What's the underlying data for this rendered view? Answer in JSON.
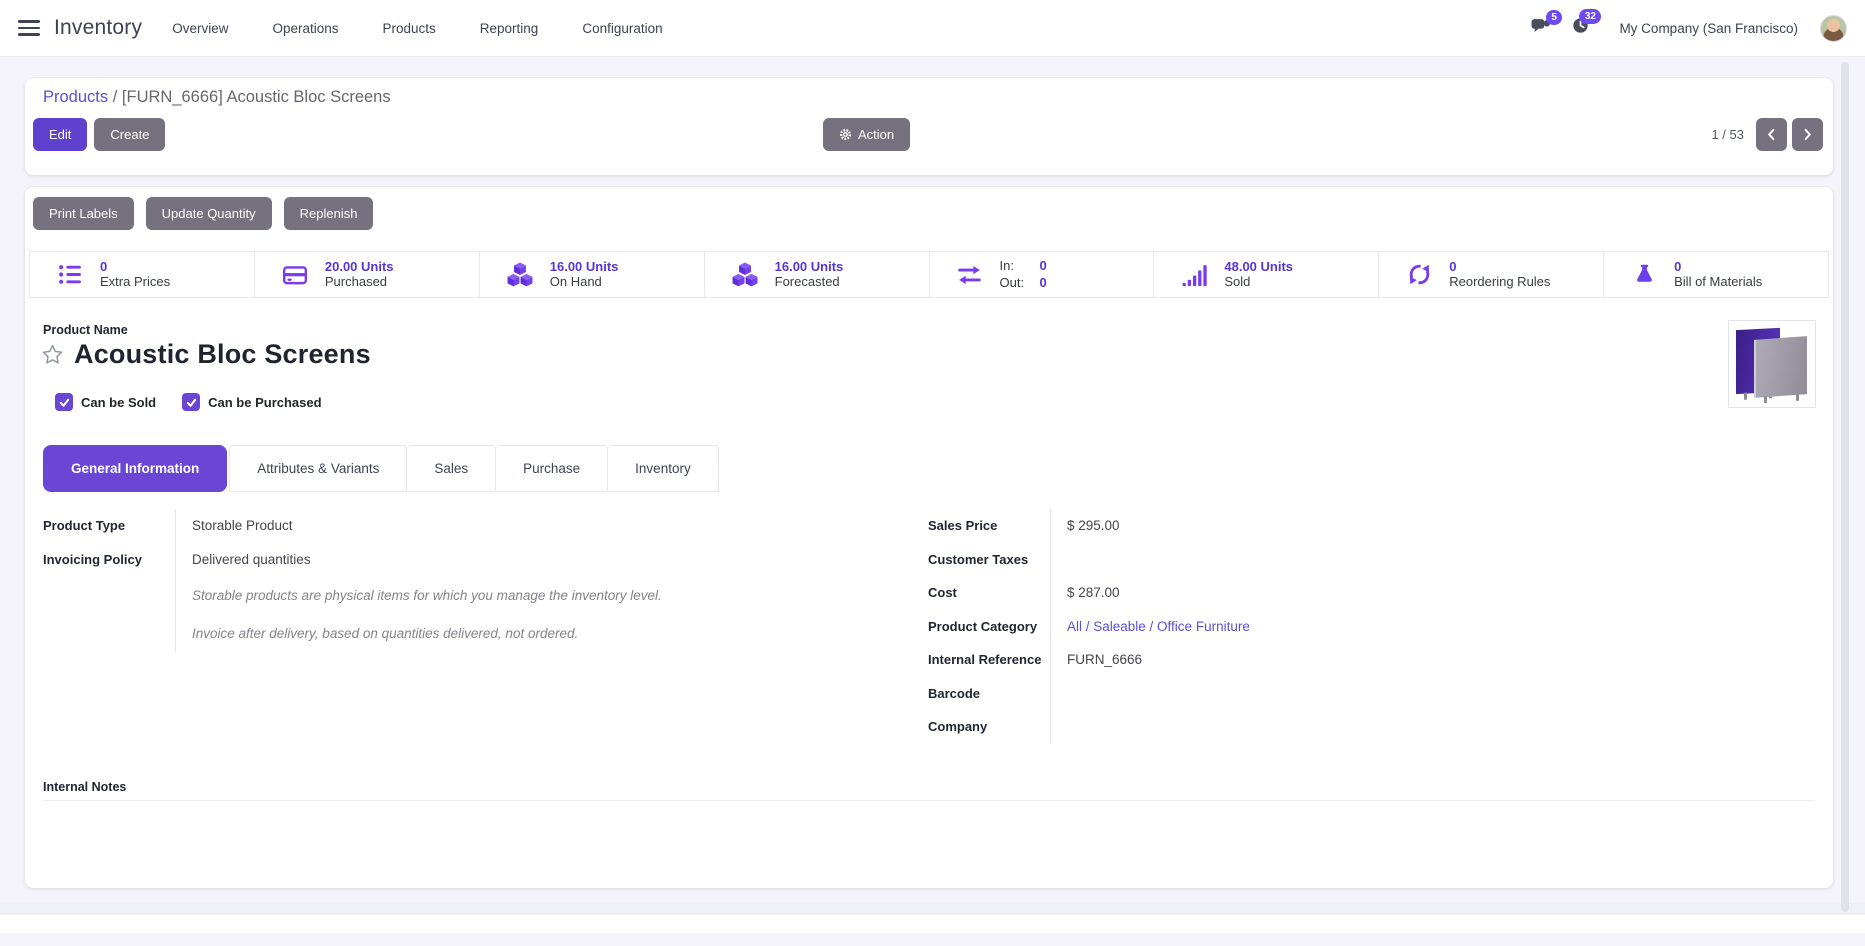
{
  "navbar": {
    "app_name": "Inventory",
    "menu": [
      "Overview",
      "Operations",
      "Products",
      "Reporting",
      "Configuration"
    ],
    "messages_badge": "5",
    "activities_badge": "32",
    "company_name": "My Company (San Francisco)"
  },
  "breadcrumb": {
    "parent": "Products",
    "separator": "/",
    "current": "[FURN_6666] Acoustic Bloc Screens"
  },
  "control_panel": {
    "edit_label": "Edit",
    "create_label": "Create",
    "action_label": "Action",
    "pager_value": "1 / 53"
  },
  "sheet_actions": {
    "print_labels": "Print Labels",
    "update_quantity": "Update Quantity",
    "replenish": "Replenish"
  },
  "stat_buttons": [
    {
      "icon": "list-icon",
      "value": "0",
      "label": "Extra Prices"
    },
    {
      "icon": "credit-card-icon",
      "value": "20.00 Units",
      "label": "Purchased"
    },
    {
      "icon": "cubes-icon",
      "value": "16.00 Units",
      "label": "On Hand"
    },
    {
      "icon": "cubes-icon",
      "value": "16.00 Units",
      "label": "Forecasted"
    },
    {
      "icon": "exchange-icon",
      "in_label": "In:",
      "in_value": "0",
      "out_label": "Out:",
      "out_value": "0"
    },
    {
      "icon": "bar-chart-icon",
      "value": "48.00 Units",
      "label": "Sold"
    },
    {
      "icon": "refresh-icon",
      "value": "0",
      "label": "Reordering Rules"
    },
    {
      "icon": "flask-icon",
      "value": "0",
      "label": "Bill of Materials"
    }
  ],
  "product": {
    "name_field_label": "Product Name",
    "name": "Acoustic Bloc Screens",
    "can_be_sold_label": "Can be Sold",
    "can_be_purchased_label": "Can be Purchased"
  },
  "tabs": [
    {
      "label": "General Information",
      "active": true
    },
    {
      "label": "Attributes & Variants",
      "active": false
    },
    {
      "label": "Sales",
      "active": false
    },
    {
      "label": "Purchase",
      "active": false
    },
    {
      "label": "Inventory",
      "active": false
    }
  ],
  "general_info": {
    "product_type_label": "Product Type",
    "product_type_value": "Storable Product",
    "invoicing_policy_label": "Invoicing Policy",
    "invoicing_policy_value": "Delivered quantities",
    "help_note_1": "Storable products are physical items for which you manage the inventory level.",
    "help_note_2": "Invoice after delivery, based on quantities delivered, not ordered.",
    "sales_price_label": "Sales Price",
    "sales_price_value": "$ 295.00",
    "customer_taxes_label": "Customer Taxes",
    "customer_taxes_value": "",
    "cost_label": "Cost",
    "cost_value": "$ 287.00",
    "product_category_label": "Product Category",
    "product_category_value": "All / Saleable / Office Furniture",
    "internal_reference_label": "Internal Reference",
    "internal_reference_value": "FURN_6666",
    "barcode_label": "Barcode",
    "barcode_value": "",
    "company_label": "Company",
    "company_value": ""
  },
  "notes_section": {
    "internal_notes_label": "Internal Notes"
  },
  "colors": {
    "primary_button": "#5f41cf",
    "active_tab": "#6b46d5",
    "stat_icon": "#7a3bf0",
    "stat_value": "#5634d8",
    "badge": "#6e49f2",
    "link": "#5a50d5",
    "muted_button": "#75717f"
  }
}
